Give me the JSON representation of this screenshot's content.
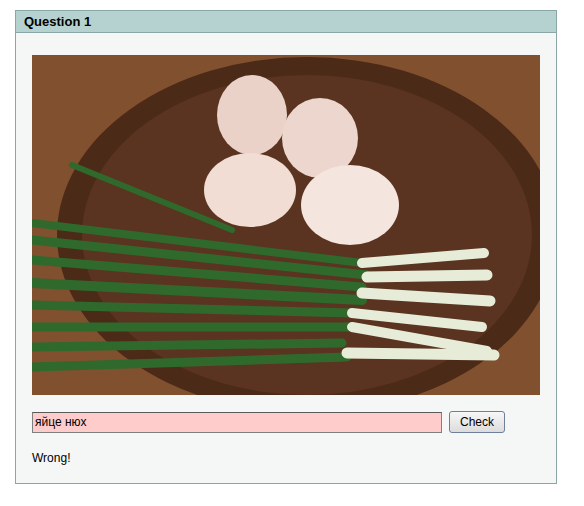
{
  "question": {
    "title": "Question 1"
  },
  "answer": {
    "value": "яйце нюх",
    "correct": false
  },
  "check_button": "Check",
  "feedback": "Wrong!"
}
